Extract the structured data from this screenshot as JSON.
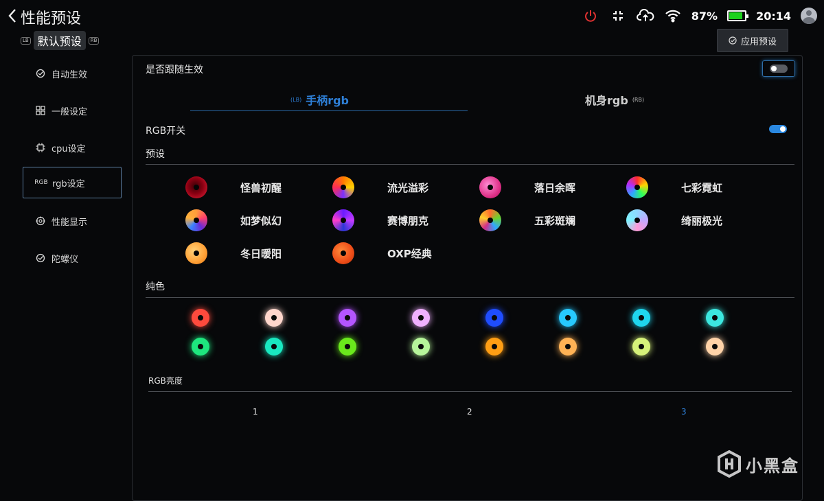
{
  "header": {
    "title": "性能预设",
    "preset_pill": {
      "left_tag": "LB",
      "label": "默认预设",
      "right_tag": "RB"
    },
    "apply_button": "应用预设"
  },
  "status_bar": {
    "battery_percent": "87%",
    "battery_level": 0.87,
    "time": "20:14",
    "icons": [
      "power-icon",
      "compress-icon",
      "cloud-upload-icon",
      "wifi-icon",
      "battery-icon",
      "avatar"
    ]
  },
  "sidebar": {
    "items": [
      {
        "label": "自动生效",
        "icon": "auto-apply-icon",
        "active": false
      },
      {
        "label": "一般设定",
        "icon": "grid-icon",
        "active": false
      },
      {
        "label": "cpu设定",
        "icon": "cpu-icon",
        "active": false
      },
      {
        "label": "rgb设定",
        "icon": "rgb-icon",
        "icon_text": "RGB",
        "active": true
      },
      {
        "label": "性能显示",
        "icon": "performance-display-icon",
        "active": false
      },
      {
        "label": "陀螺仪",
        "icon": "gyroscope-icon",
        "active": false
      }
    ]
  },
  "panel": {
    "follow_label": "是否跟随生效",
    "follow_on": false,
    "tabs": [
      {
        "prefix": "(LB)",
        "label": "手柄rgb",
        "suffix": "",
        "active": true
      },
      {
        "prefix": "",
        "label": "机身rgb",
        "suffix": "(RB)",
        "active": false
      }
    ],
    "rgb_switch_label": "RGB开关",
    "rgb_switch_on": true,
    "presets_label": "预设",
    "presets": [
      {
        "name": "怪兽初醒"
      },
      {
        "name": "流光溢彩"
      },
      {
        "name": "落日余晖"
      },
      {
        "name": "七彩霓虹"
      },
      {
        "name": "如梦似幻"
      },
      {
        "name": "赛博朋克"
      },
      {
        "name": "五彩斑斓"
      },
      {
        "name": "绮丽极光"
      },
      {
        "name": "冬日暖阳"
      },
      {
        "name": "OXP经典"
      }
    ],
    "solid_label": "纯色",
    "solid_colors": [
      "#ff4a3d",
      "#ffd6cc",
      "#b455ff",
      "#f0b0ff",
      "#1f4dff",
      "#27c9ff",
      "#1fd6ee",
      "#3ce8e0",
      "#1ee67e",
      "#19e8c0",
      "#6ae81c",
      "#b6f59a",
      "#ff9e14",
      "#ffb255",
      "#d6f27a",
      "#ffd3a8"
    ],
    "brightness_label": "RGB亮度",
    "brightness_levels": [
      "1",
      "2",
      "3"
    ],
    "brightness_selected": "3"
  },
  "watermark": {
    "text": "小黑盒"
  },
  "colors": {
    "accent": "#2a88e0",
    "active_tab_text": "#2e7fd6",
    "power_red": "#e03131",
    "battery_green": "#1dd11d"
  }
}
